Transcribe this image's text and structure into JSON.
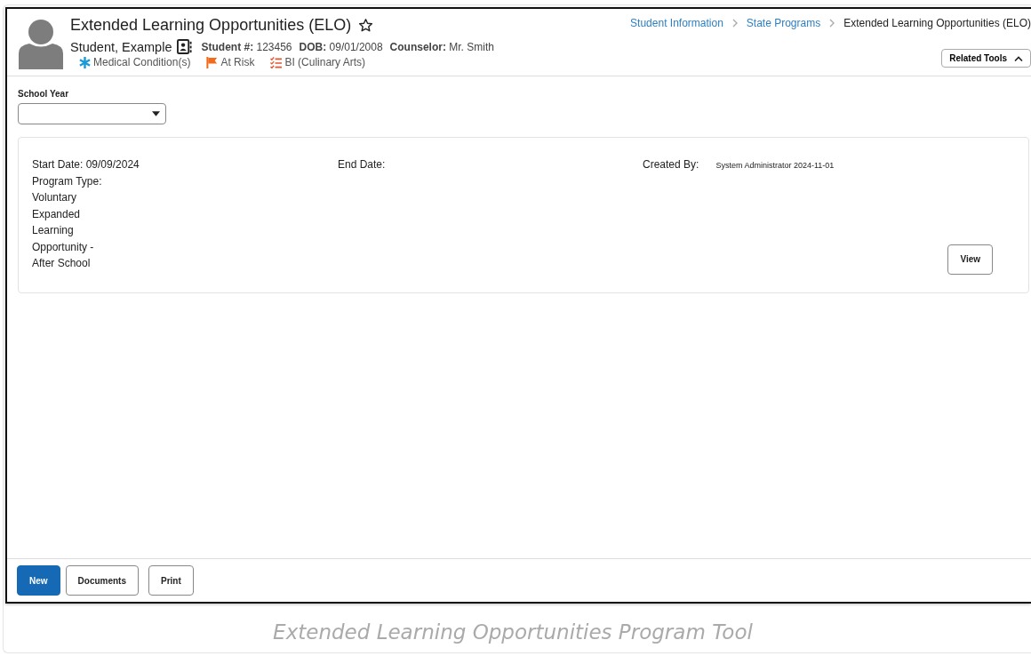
{
  "header": {
    "title": "Extended Learning Opportunities (ELO)",
    "student_name": "Student, Example",
    "fields": [
      {
        "label": "Student #:",
        "value": "123456"
      },
      {
        "label": "DOB:",
        "value": "09/01/2008"
      },
      {
        "label": "Counselor:",
        "value": "Mr. Smith"
      }
    ],
    "flags": [
      {
        "kind": "medical",
        "label": "Medical Condition(s)"
      },
      {
        "kind": "flag",
        "label": "At Risk"
      },
      {
        "kind": "checklist",
        "label": "BI (Culinary Arts)"
      }
    ]
  },
  "breadcrumb": [
    {
      "label": "Student Information",
      "kind": "link"
    },
    {
      "label": "State Programs",
      "kind": "link"
    },
    {
      "label": "Extended Learning Opportunities (ELO)",
      "kind": "current"
    }
  ],
  "related_tools": {
    "label": "Related Tools",
    "expanded": true
  },
  "school_year": {
    "label": "School Year"
  },
  "records": [
    {
      "start_date": "Start Date: 09/09/2024",
      "program_type_label": "Program Type:",
      "program_type": "Voluntary Expanded Learning Opportunity - After School",
      "end_date": "End Date:",
      "created_by_label": "Created By:",
      "created_by": "System Administrator 2024-11-01",
      "button": "View"
    }
  ],
  "footer_buttons": [
    {
      "label": "New",
      "kind": "primary"
    },
    {
      "label": "Documents",
      "kind": "secondary"
    },
    {
      "label": "Print",
      "kind": "secondary"
    }
  ],
  "caption": "Extended Learning Opportunities Program Tool"
}
